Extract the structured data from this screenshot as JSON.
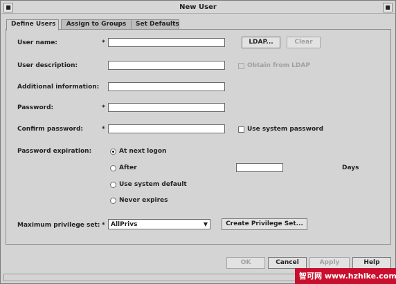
{
  "window": {
    "title": "New User"
  },
  "tabs": [
    {
      "label": "Define Users",
      "active": true
    },
    {
      "label": "Assign to Groups",
      "active": false
    },
    {
      "label": "Set Defaults",
      "active": false
    }
  ],
  "form": {
    "required_marker": "*",
    "user_name": {
      "label": "User name:",
      "value": ""
    },
    "ldap_button": "LDAP...",
    "clear_button": "Clear",
    "user_description": {
      "label": "User description:",
      "value": ""
    },
    "obtain_from_ldap": {
      "label": "Obtain from LDAP",
      "checked": false,
      "enabled": false
    },
    "additional_information": {
      "label": "Additional information:",
      "value": ""
    },
    "password": {
      "label": "Password:",
      "value": ""
    },
    "confirm_password": {
      "label": "Confirm password:",
      "value": ""
    },
    "use_system_password": {
      "label": "Use system password",
      "checked": false
    },
    "password_expiration": {
      "label": "Password expiration:",
      "options": [
        {
          "label": "At next logon",
          "checked": true
        },
        {
          "label": "After",
          "checked": false
        },
        {
          "label": "Use system default",
          "checked": false
        },
        {
          "label": "Never expires",
          "checked": false
        }
      ],
      "after_days_value": "",
      "days_label": "Days"
    },
    "maximum_privilege_set": {
      "label": "Maximum privilege set:",
      "selected": "AllPrivs"
    },
    "create_privilege_set_button": "Create Privilege Set..."
  },
  "footer_buttons": {
    "ok": "OK",
    "cancel": "Cancel",
    "apply": "Apply",
    "help": "Help"
  },
  "watermark": {
    "text": "智可网 www.hzhike.com"
  },
  "icons": {
    "window_menu": "window-menu-icon",
    "close": "close-icon",
    "dropdown": "chevron-down-icon",
    "radio": "radio-icon"
  }
}
